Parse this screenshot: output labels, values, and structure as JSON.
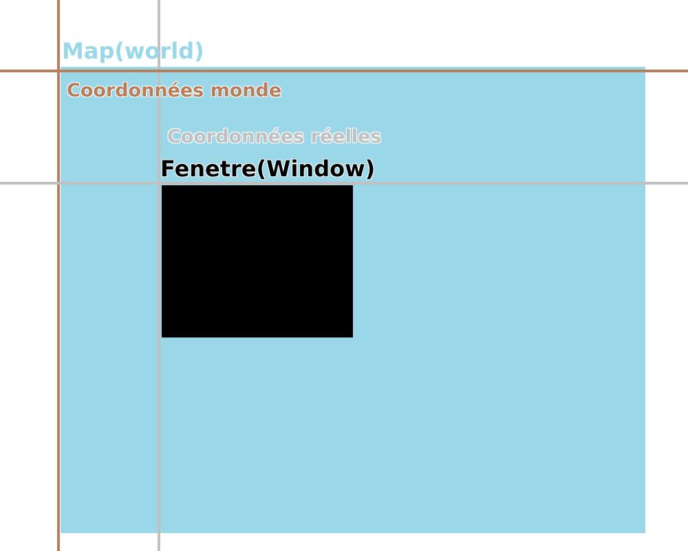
{
  "labels": {
    "map": "Map(world)",
    "world_coords": "Coordonnées monde",
    "real_coords": "Coordonnées réelles",
    "window": "Fenetre(Window)"
  },
  "colors": {
    "background": "#ffffff",
    "map_fill": "#9ad8e9",
    "world_axis": "#b67e5a",
    "real_axis": "#c0c0c0",
    "window_fill": "#000000",
    "map_label": "#9ad8e9",
    "world_label": "#b67e5a",
    "real_label": "#c0c0c0",
    "window_label": "#000000"
  }
}
